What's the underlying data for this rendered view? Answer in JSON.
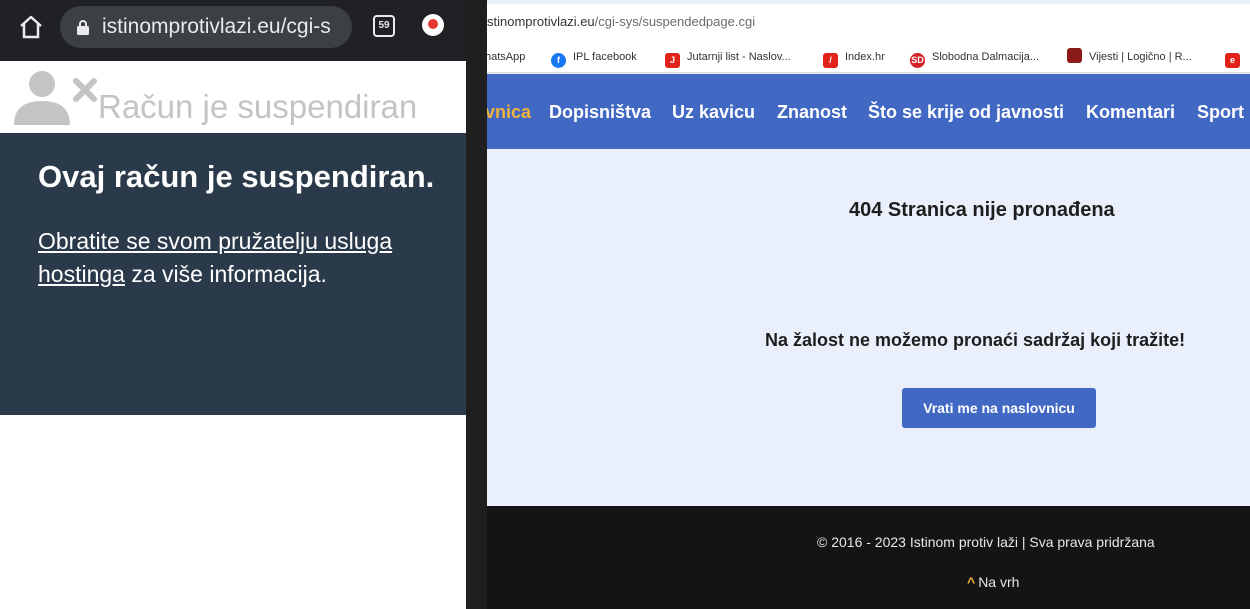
{
  "mobile": {
    "url": "istinomprotivlazi.eu/cgi-s",
    "tab_count": "59",
    "icons": [
      "home-icon",
      "lock-icon",
      "tab-switcher-icon",
      "update-icon",
      "user-suspended-icon"
    ],
    "header_title": "Račun je suspendiran",
    "panel_title": "Ovaj račun je suspendiran.",
    "panel_link": "Obratite se svom pružatelju usluga hostinga",
    "panel_rest": " za više informacija.",
    "colors": {
      "topbar": "#202124",
      "panel": "#2b3a4a"
    }
  },
  "desktop": {
    "url_host": "stinomprotivlazi.eu",
    "url_path": "/cgi-sys/suspendedpage.cgi",
    "bookmarks": [
      {
        "label": "hatsApp",
        "icon": "whatsapp-icon"
      },
      {
        "label": "IPL facebook",
        "icon": "facebook-icon",
        "color": "#1877f2"
      },
      {
        "label": "Jutarnji list - Naslov...",
        "icon": "jutarnji-icon",
        "color": "#e2231a"
      },
      {
        "label": "Index.hr",
        "icon": "index-icon",
        "color": "#e2231a"
      },
      {
        "label": "Slobodna Dalmacija...",
        "icon": "slobodna-dalmacija-icon",
        "color": "#d51f26"
      },
      {
        "label": "Vijesti | Logično | R...",
        "icon": "vijesti-icon",
        "color": "#8b1a1a"
      },
      {
        "label": "",
        "icon": "e-icon",
        "color": "#e2231a"
      }
    ],
    "nav": [
      {
        "label": "vnica",
        "active": true
      },
      {
        "label": "Dopisništva"
      },
      {
        "label": "Uz kavicu"
      },
      {
        "label": "Znanost"
      },
      {
        "label": "Što se krije od javnosti"
      },
      {
        "label": "Komentari"
      },
      {
        "label": "Sport"
      }
    ],
    "heading_404": "404 Stranica nije pronađena",
    "sorry_text": "Na žalost ne možemo pronaći sadržaj koji tražite!",
    "home_button": "Vrati me na naslovnicu",
    "footer_copy": "© 2016 - 2023 Istinom protiv laži | Sva prava pridržana",
    "footer_top": "Na vrh",
    "colors": {
      "accent": "#4169c4",
      "nav_active": "#f0b23e",
      "footer": "#141414",
      "main_bg": "#eaf0fb"
    }
  }
}
